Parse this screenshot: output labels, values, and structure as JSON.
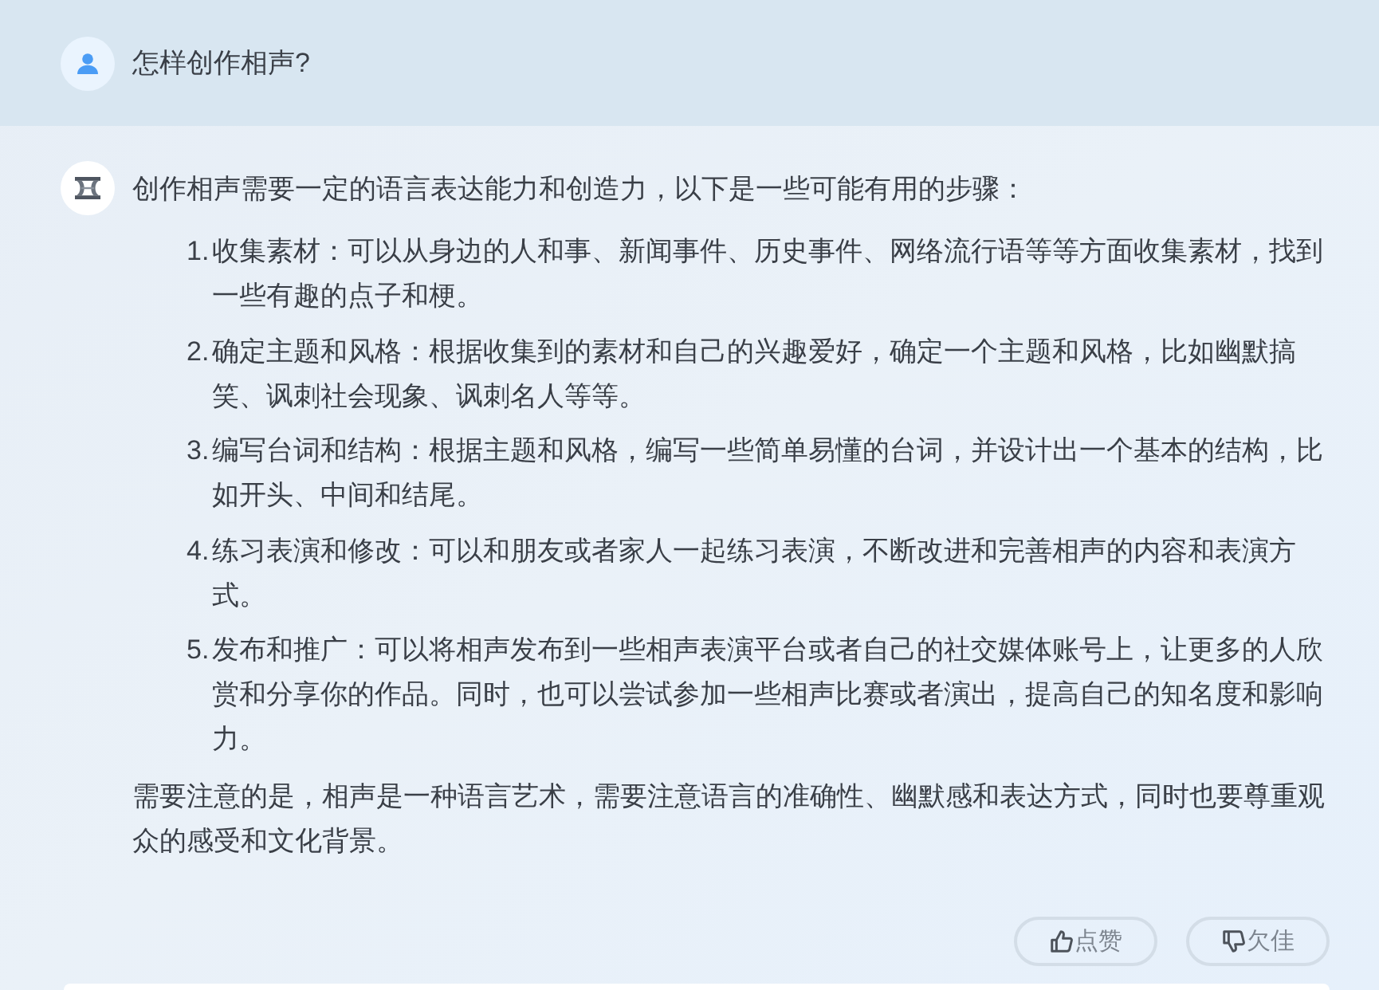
{
  "question": {
    "text": "怎样创作相声?"
  },
  "answer": {
    "intro": "创作相声需要一定的语言表达能力和创造力，以下是一些可能有用的步骤：",
    "steps": [
      {
        "number": "1.",
        "text": "收集素材：可以从身边的人和事、新闻事件、历史事件、网络流行语等等方面收集素材，找到一些有趣的点子和梗。"
      },
      {
        "number": "2.",
        "text": "确定主题和风格：根据收集到的素材和自己的兴趣爱好，确定一个主题和风格，比如幽默搞笑、讽刺社会现象、讽刺名人等等。"
      },
      {
        "number": "3.",
        "text": "编写台词和结构：根据主题和风格，编写一些简单易懂的台词，并设计出一个基本的结构，比如开头、中间和结尾。"
      },
      {
        "number": "4.",
        "text": "练习表演和修改：可以和朋友或者家人一起练习表演，不断改进和完善相声的内容和表演方式。"
      },
      {
        "number": "5.",
        "text": "发布和推广：可以将相声发布到一些相声表演平台或者自己的社交媒体账号上，让更多的人欣赏和分享你的作品。同时，也可以尝试参加一些相声比赛或者演出，提高自己的知名度和影响力。"
      }
    ],
    "closing": "需要注意的是，相声是一种语言艺术，需要注意语言的准确性、幽默感和表达方式，同时也要尊重观众的感受和文化背景。"
  },
  "feedback_buttons": [
    {
      "kind": "like",
      "label": "点赞"
    },
    {
      "kind": "dislike",
      "label": "欠佳"
    }
  ]
}
